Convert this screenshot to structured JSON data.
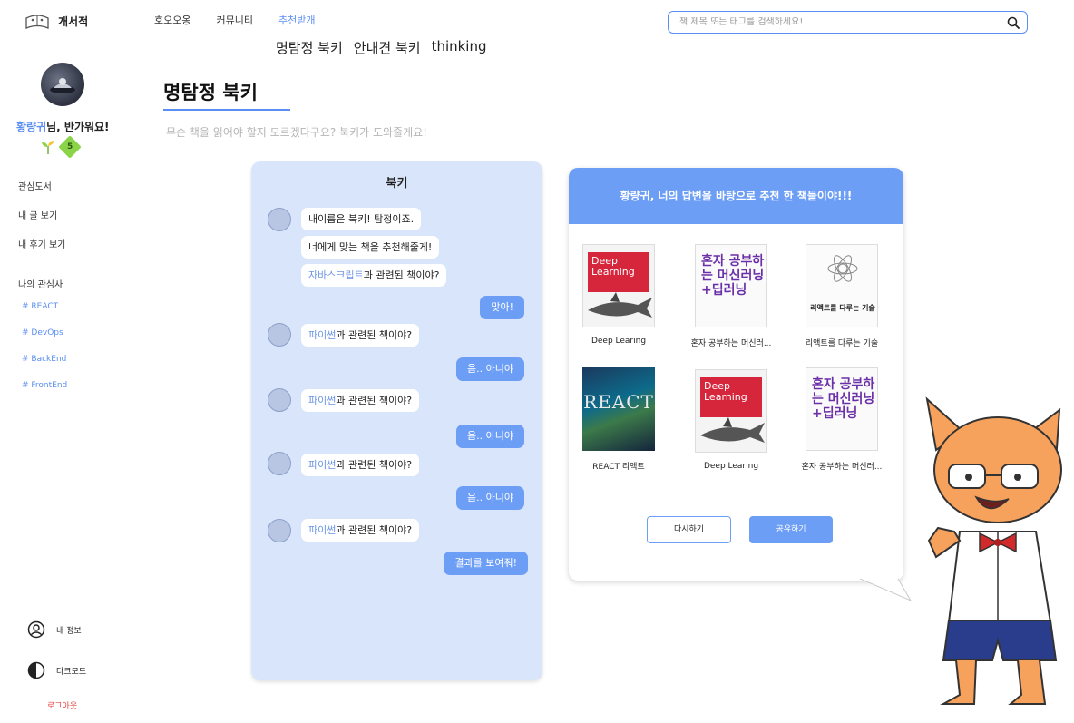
{
  "app": {
    "name": "개서적"
  },
  "user": {
    "name": "황량귀",
    "greeting_suffix": "님, 반가워요!",
    "level": "5"
  },
  "sidebar": {
    "menu": [
      "관심도서",
      "내 글 보기",
      "내 후기 보기"
    ],
    "interest_title": "나의 관심사",
    "tags": [
      "# REACT",
      "# DevOps",
      "# BackEnd",
      "# FrontEnd"
    ],
    "my_info": "내 정보",
    "dark_mode": "다크모드",
    "logout": "로그아웃"
  },
  "nav": {
    "items": [
      "호오오옹",
      "커뮤니티",
      "추천받개"
    ],
    "active": "추천받개"
  },
  "subnav": [
    "명탐정 북키",
    "안내견 북키",
    "thinking"
  ],
  "search": {
    "placeholder": "책 제목 또는 태그를 검색하세요!"
  },
  "page": {
    "title": "명탐정 북키",
    "subtitle": "무슨 책을 읽어야 할지 모르겠다구요? 북키가 도와줄게요!"
  },
  "chat": {
    "title": "북키",
    "intro": [
      "내이름은 북키! 탐정이죠.",
      "너에게 맞는 책을 추천해줄게!"
    ],
    "q1_highlight": "자바스크립트",
    "q1_rest": "과 관련된 책이야?",
    "a1": "맞아!",
    "q_highlight": "파이썬",
    "q_rest": "과 관련된 책이야?",
    "no": "음.. 아니야",
    "result_button": "결과를 보여줘!"
  },
  "results": {
    "header": "황량귀, 너의 답변을 바탕으로 추천 한 책들이야!!!",
    "books": [
      {
        "title": "Deep Learing",
        "cover_text": "Deep Learning"
      },
      {
        "title": "혼자 공부하는 머신러...",
        "cover_text": "혼자 공부하는 머신러닝+딥러닝"
      },
      {
        "title": "리액트를 다루는 기술",
        "cover_text": "리액트를 다루는 기술"
      },
      {
        "title": "REACT 리액트",
        "cover_text": "REACT"
      },
      {
        "title": "Deep Learing",
        "cover_text": "Deep Learning"
      },
      {
        "title": "혼자 공부하는 머신러...",
        "cover_text": "혼자 공부하는 머신러닝+딥러닝"
      }
    ],
    "retry_button": "다시하기",
    "share_button": "공유하기"
  },
  "colors": {
    "accent": "#5a8ef2",
    "chat_bg": "#d9e5fb",
    "bubble_reply": "#6d9ef6",
    "logout": "#e54545",
    "mascot": "#f7a25c"
  }
}
